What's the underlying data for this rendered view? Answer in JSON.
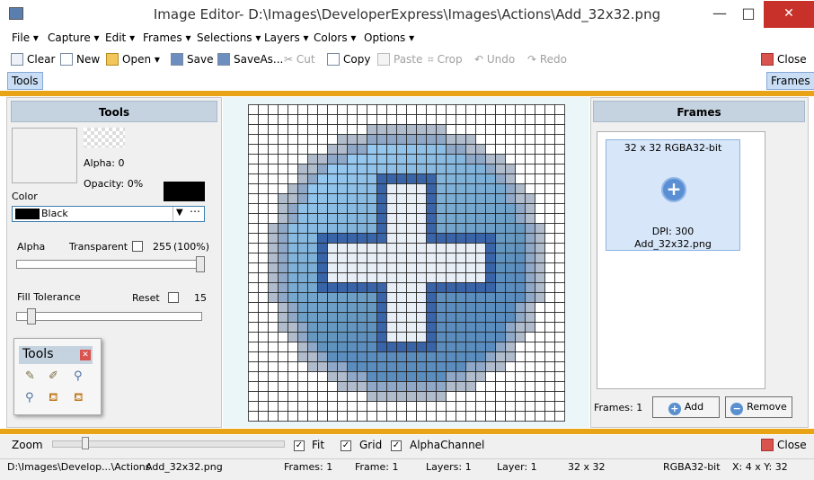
{
  "window": {
    "title": "Image Editor- D:\\Images\\DeveloperExpress\\Images\\Actions\\Add_32x32.png",
    "minimize": "—",
    "maximize": "□",
    "close": "✕"
  },
  "menu": [
    {
      "id": "file",
      "label": "File"
    },
    {
      "id": "capture",
      "label": "Capture"
    },
    {
      "id": "edit",
      "label": "Edit"
    },
    {
      "id": "frames",
      "label": "Frames"
    },
    {
      "id": "selections",
      "label": "Selections"
    },
    {
      "id": "layers",
      "label": "Layers"
    },
    {
      "id": "colors",
      "label": "Colors"
    },
    {
      "id": "options",
      "label": "Options"
    }
  ],
  "toolbar": {
    "clear": "Clear",
    "new": "New",
    "open": "Open",
    "save": "Save",
    "saveas": "SaveAs...",
    "cut": "Cut",
    "copy": "Copy",
    "paste": "Paste",
    "crop": "Crop",
    "undo": "Undo",
    "redo": "Redo",
    "close": "Close"
  },
  "tabs": {
    "tools": "Tools",
    "frames": "Frames"
  },
  "tools_panel": {
    "header": "Tools",
    "alpha_text": "Alpha: 0",
    "opacity_text": "Opacity: 0%",
    "color_label": "Color",
    "color_value": "Black",
    "alpha_label": "Alpha",
    "transparent_label": "Transparent",
    "alpha_value": "255",
    "alpha_percent": "(100%)",
    "alpha_level": 1.0,
    "fill_tolerance_label": "Fill Tolerance",
    "reset_label": "Reset",
    "fill_value": "15",
    "fill_level": 0.06,
    "mini_title": "Tools"
  },
  "frames_panel": {
    "header": "Frames",
    "frame_format": "32 x 32 RGBA32-bit",
    "frame_dpi": "DPI: 300",
    "frame_name": "Add_32x32.png",
    "frames_count": "Frames: 1",
    "add": "Add",
    "remove": "Remove"
  },
  "bottom": {
    "zoom": "Zoom",
    "zoom_level": 0.13,
    "fit": "Fit",
    "grid": "Grid",
    "alpha_channel": "AlphaChannel",
    "close": "Close"
  },
  "status": {
    "path": "D:\\Images\\Develop...\\Actions",
    "file": "Add_32x32.png",
    "frames": "Frames: 1",
    "frame": "Frame: 1",
    "layers": "Layers: 1",
    "layer": "Layer: 1",
    "size": "32 x 32",
    "format": "RGBA32-bit",
    "xy": "X: 4 x Y: 32"
  },
  "colors": {
    "accent_orange": "#e8a317",
    "tab_blue": "#c9def5",
    "close_red": "#c7312a",
    "selected_color": "#000000"
  }
}
